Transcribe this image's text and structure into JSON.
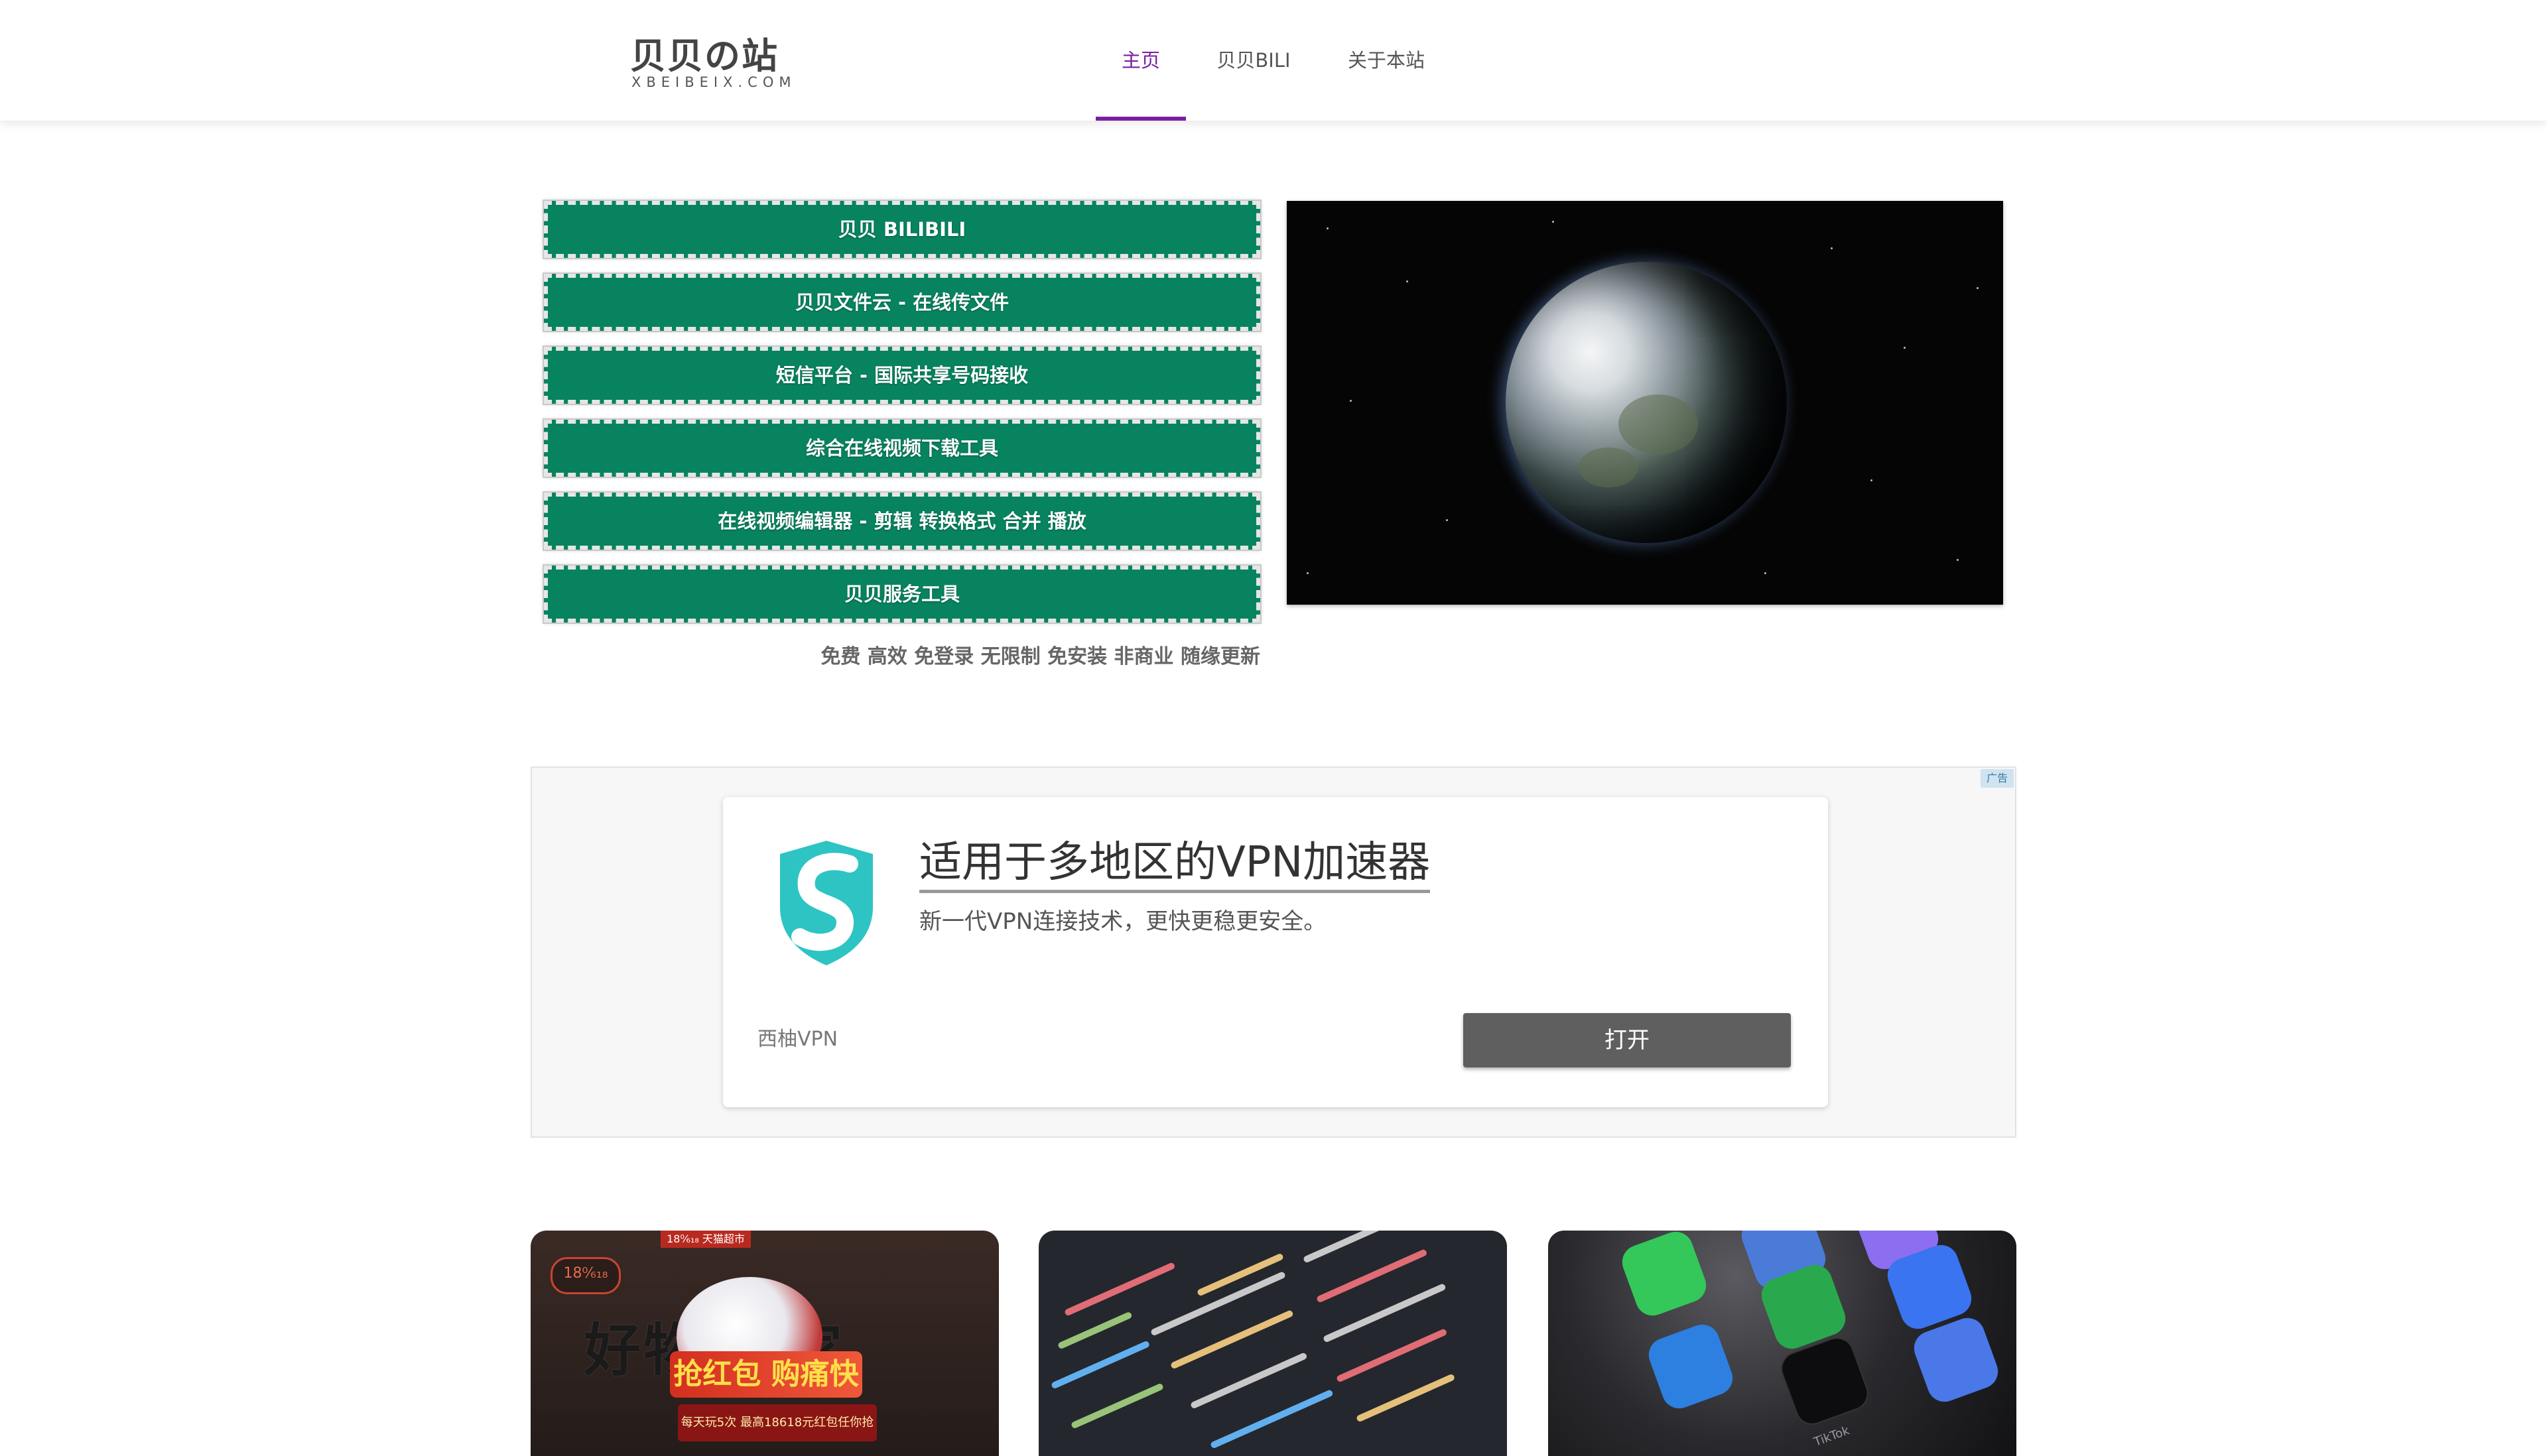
{
  "header": {
    "logo_title": "贝贝の站",
    "logo_subtitle": "XBEIBEIX.COM",
    "nav": [
      {
        "label": "主页",
        "active": true
      },
      {
        "label": "贝贝BILI",
        "active": false
      },
      {
        "label": "关于本站",
        "active": false
      }
    ],
    "accent_color": "#7a1fa2"
  },
  "hero": {
    "buttons": [
      {
        "label": "贝贝 BILIBILI"
      },
      {
        "label": "贝贝文件云 - 在线传文件"
      },
      {
        "label": "短信平台 - 国际共享号码接收"
      },
      {
        "label": "综合在线视频下载工具"
      },
      {
        "label": "在线视频编辑器 - 剪辑 转换格式 合并 播放"
      },
      {
        "label": "贝贝服务工具"
      }
    ],
    "button_color": "#07835f",
    "tagline": "免费 高效 免登录 无限制 免安装 非商业 随缘更新",
    "image_icon": "earth-image"
  },
  "ad": {
    "badge": "广告",
    "title": "适用于多地区的VPN加速器",
    "description": "新一代VPN连接技术，更快更稳更安全。",
    "advertiser": "西柚VPN",
    "cta_label": "打开",
    "logo_icon": "shield-s-logo-icon",
    "logo_color": "#2ec4c4"
  },
  "cards": {
    "card1": {
      "tag": "18⁰⁄₆₁₈",
      "top_banner": "18⁰⁄₆₁₈ 天猫超市",
      "headline": "好物  言家",
      "banner": "抢红包 购痛快",
      "small_text": "每天玩5次 最高18618元红包任你抢"
    },
    "card2": {
      "image_icon": "code-screen-image"
    },
    "card3": {
      "image_icon": "phone-apps-image",
      "app_label": "TikTok"
    }
  }
}
